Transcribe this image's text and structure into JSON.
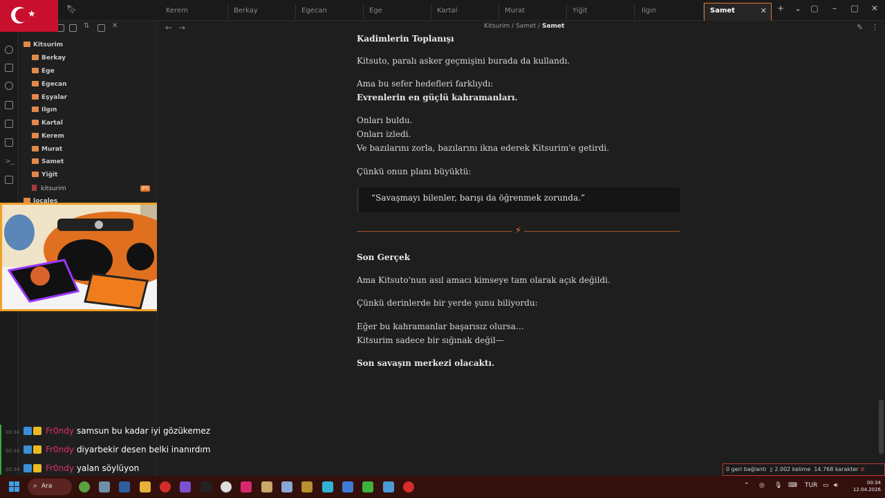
{
  "tabs": [
    "Kerem",
    "Berkay",
    "Egecan",
    "Ege",
    "Kartal",
    "Murat",
    "Yiğit",
    "Ilgın",
    "Samet"
  ],
  "active_tab": "Samet",
  "breadcrumb": {
    "root": "Kitsurim",
    "sep": "/",
    "parent": "Samet",
    "current": "Samet"
  },
  "sidebar": {
    "root": "Kitsurim",
    "folders": [
      "Berkay",
      "Ege",
      "Egecan",
      "Eşyalar",
      "Ilgın",
      "Kartal",
      "Kerem",
      "Murat",
      "Samet",
      "Yiğit"
    ],
    "file": "kitsurim",
    "file_badge": "JPG",
    "folder2": "locales"
  },
  "doc": {
    "h1": "Kadimlerin Toplanışı",
    "p1": "Kitsuto, paralı asker geçmişini burada da kullandı.",
    "p2": "Ama bu sefer hedefleri farklıydı:",
    "p2b": "Evrenlerin en güçlü kahramanları.",
    "p3a": "Onları buldu.",
    "p3b": "Onları izledi.",
    "p3c": "Ve bazılarını zorla, bazılarını ikna ederek Kitsurim'e getirdi.",
    "p4": "Çünkü onun planı büyüktü:",
    "quote": "“Savaşmayı bilenler, barışı da öğrenmek zorunda.”",
    "divider_symbol": "⚡",
    "h2": "Son Gerçek",
    "p5": "Ama Kitsuto'nun asıl amacı kimseye tam olarak açık değildi.",
    "p6": "Çünkü derinlerde bir yerde şunu biliyordu:",
    "p7a": "Eğer bu kahramanlar başarısız olursa…",
    "p7b": "Kitsurim sadece bir sığınak değil—",
    "p8": "Son savaşın merkezi olacaktı."
  },
  "chat": [
    {
      "time": "00:34",
      "user": "Fr0ndy",
      "message": "samsun bu kadar iyi gözükemez"
    },
    {
      "time": "00:34",
      "user": "Fr0ndy",
      "message": "diyarbekir desen belki inanırdım"
    },
    {
      "time": "00:34",
      "user": "Fr0ndy",
      "message": "yalan söylüyon"
    }
  ],
  "status": {
    "backlinks": "0 geri bağlantı",
    "words": "2.002 kelime",
    "chars": "14.768 karakter"
  },
  "taskbar": {
    "search_label": "Ara",
    "lang": "TUR",
    "time": "00:34",
    "date": "12.04.2026"
  },
  "colors": {
    "accent": "#e07a2f",
    "chat_user": "#e1306c",
    "taskbar": "#34100d"
  }
}
